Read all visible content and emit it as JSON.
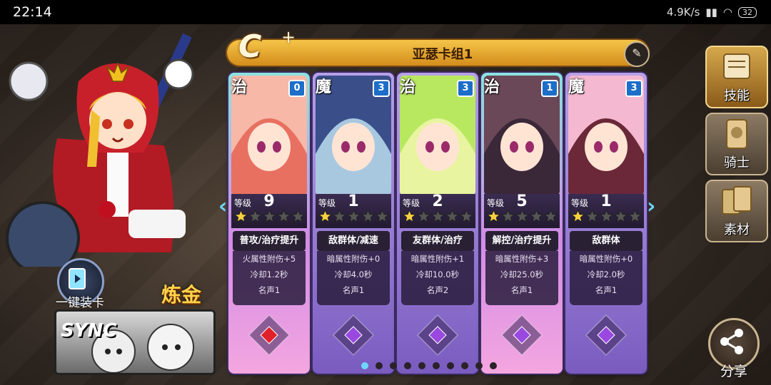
{
  "status_bar": {
    "time": "22:14",
    "network_speed": "4.9K/s",
    "battery": "32"
  },
  "deck": {
    "grade": "C",
    "grade_plus": "+",
    "name": "亚瑟卡组1",
    "edit_icon": "quill-icon"
  },
  "cards": [
    {
      "type": "治",
      "cost": "0",
      "level_label": "等级",
      "level": "9",
      "stars": 1,
      "skill": "普攻/治疗提升",
      "line1": "火属性附伤+5",
      "line2": "冷却1.2秒",
      "line3": "名声1",
      "gem_color": "#e0202a",
      "variant": "heal"
    },
    {
      "type": "魔",
      "cost": "3",
      "level_label": "等级",
      "level": "1",
      "stars": 1,
      "skill": "敌群体/减速",
      "line1": "暗属性附伤+0",
      "line2": "冷却4.0秒",
      "line3": "名声1",
      "gem_color": "#9a48e0",
      "variant": "magic"
    },
    {
      "type": "治",
      "cost": "3",
      "level_label": "等级",
      "level": "2",
      "stars": 1,
      "skill": "友群体/治疗",
      "line1": "暗属性附伤+1",
      "line2": "冷却10.0秒",
      "line3": "名声2",
      "gem_color": "#9a48e0",
      "variant": "magic"
    },
    {
      "type": "治",
      "cost": "1",
      "level_label": "等级",
      "level": "5",
      "stars": 1,
      "skill": "解控/治疗提升",
      "line1": "暗属性附伤+3",
      "line2": "冷却25.0秒",
      "line3": "名声1",
      "gem_color": "#9a48e0",
      "variant": "heal"
    },
    {
      "type": "魔",
      "cost": "3",
      "level_label": "等级",
      "level": "1",
      "stars": 1,
      "skill": "敌群体",
      "line1": "暗属性附伤+0",
      "line2": "冷却2.0秒",
      "line3": "名声1",
      "gem_color": "#9a48e0",
      "variant": "magic"
    }
  ],
  "side_menu": [
    {
      "label": "技能",
      "icon": "scroll-icon",
      "active": true
    },
    {
      "label": "骑士",
      "icon": "knight-card-icon",
      "active": false
    },
    {
      "label": "素材",
      "icon": "material-cards-icon",
      "active": false
    }
  ],
  "bottom_left": {
    "quick_equip_label": "一键装卡",
    "alchemy_label": "炼金",
    "sync_label": "SYNC"
  },
  "share": {
    "label": "分享"
  },
  "pagination": {
    "total": 10,
    "current": 1
  },
  "colors": {
    "accent": "#f7c84b",
    "dot_active": "#6fd6ff"
  }
}
